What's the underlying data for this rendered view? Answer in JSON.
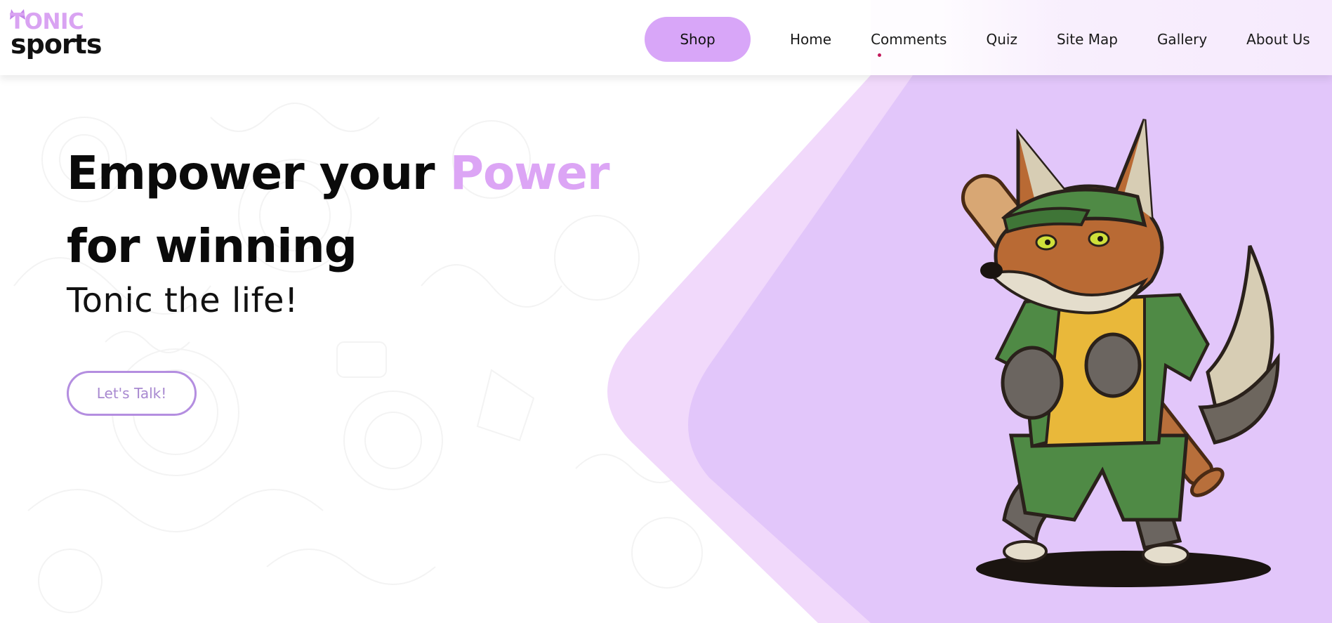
{
  "header": {
    "logo": {
      "line1": "TONIC",
      "line2": "sports"
    },
    "nav": {
      "shop_label": "Shop",
      "items": [
        "Home",
        "Comments",
        "Quiz",
        "Site Map",
        "Gallery",
        "About Us"
      ]
    }
  },
  "hero": {
    "headline_part1": "Empower your ",
    "headline_accent": "Power",
    "headline_part2": "for winning",
    "subhead": "Tonic the life!",
    "cta_label": "Let's Talk!"
  },
  "colors": {
    "accent": "#dca5f5",
    "shop_button": "#d8a6f8",
    "cta_border": "#b48ee0",
    "panel_light": "#f1d9fb",
    "panel_dark": "#e2c6fa"
  },
  "icons": {
    "mascot": "fox-baseball-player-icon"
  }
}
